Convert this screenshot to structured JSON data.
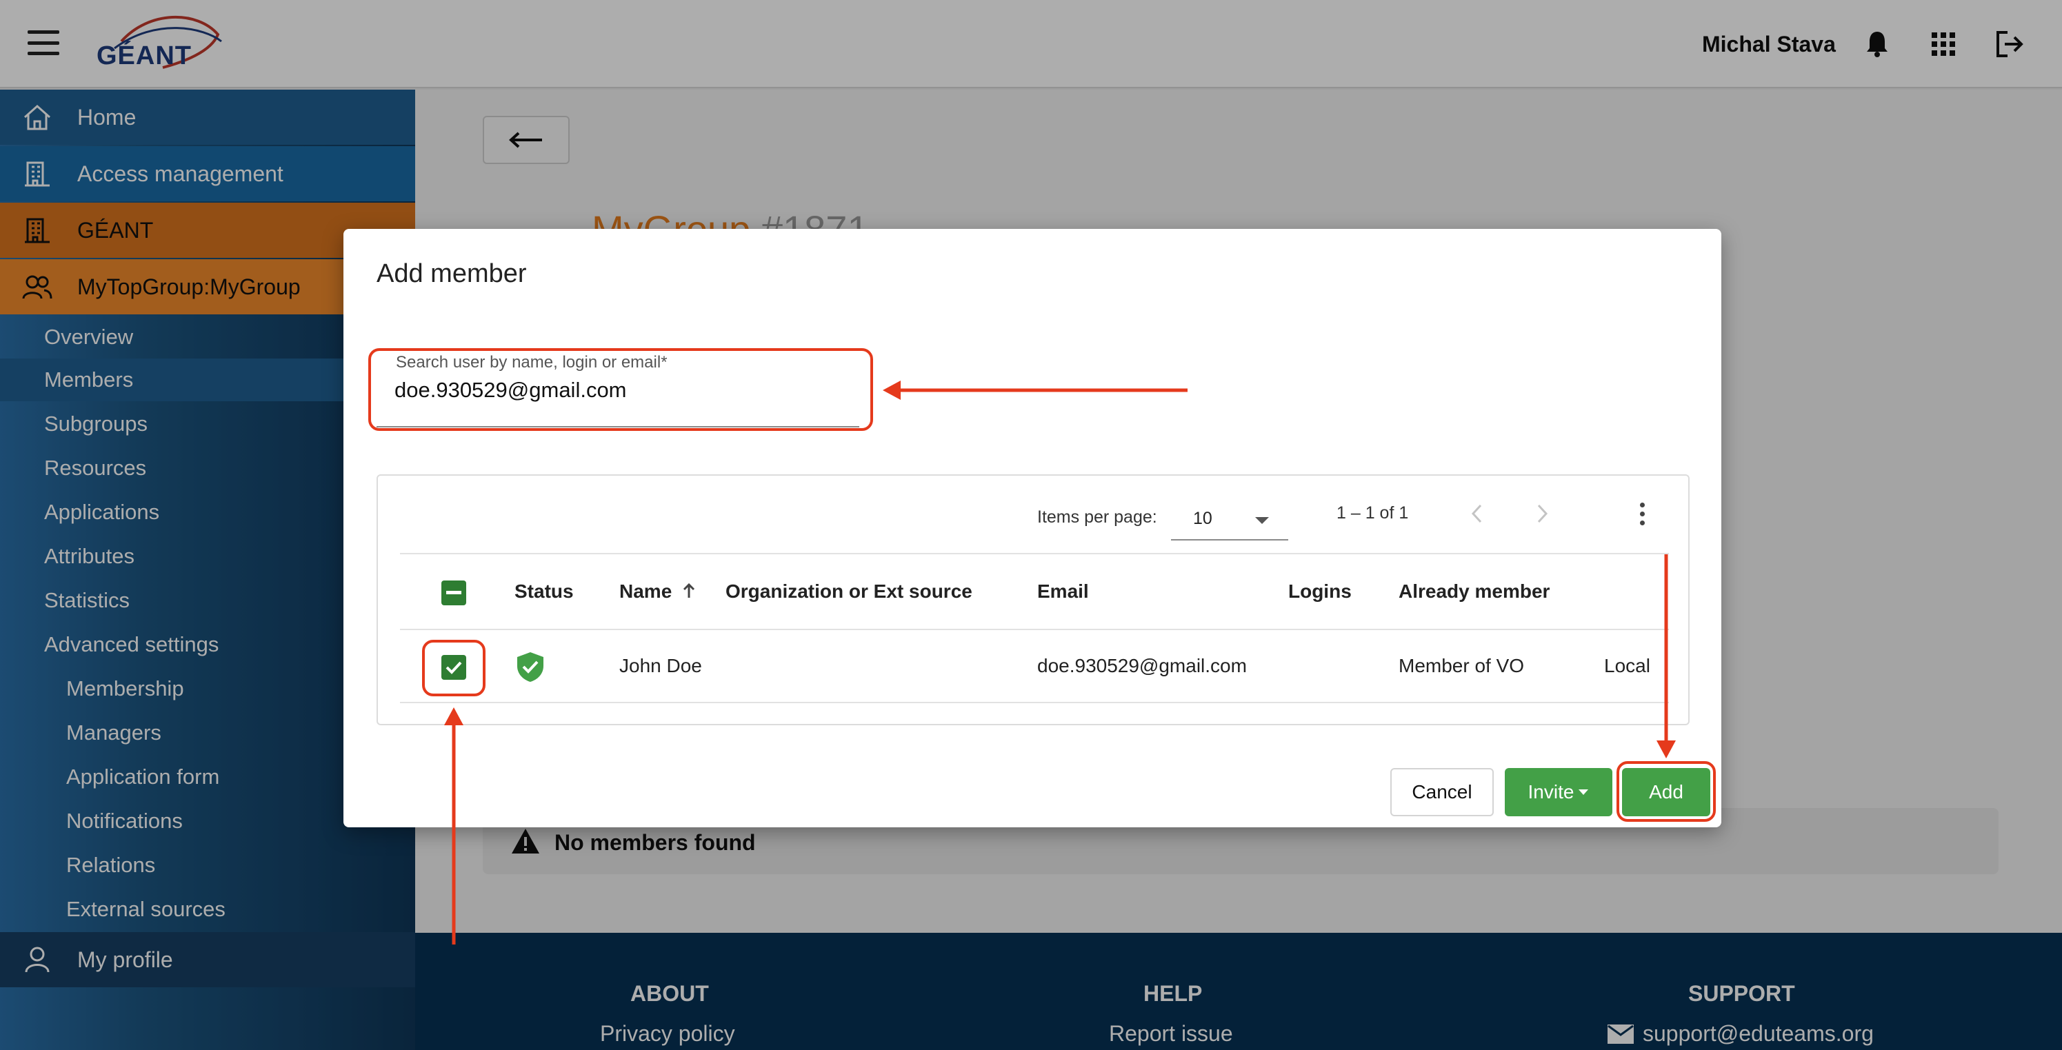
{
  "header": {
    "logo_text": "GÉANT",
    "username": "Michal Stava"
  },
  "sidebar": {
    "items": [
      {
        "label": "Home",
        "icon": "home-icon"
      },
      {
        "label": "Access management",
        "icon": "building-icon"
      },
      {
        "label": "GÉANT",
        "icon": "building-icon"
      },
      {
        "label": "MyTopGroup:MyGroup",
        "icon": "group-icon"
      }
    ],
    "sub_items": [
      "Overview",
      "Members",
      "Subgroups",
      "Resources",
      "Applications",
      "Attributes",
      "Statistics",
      "Advanced settings"
    ],
    "advanced_items": [
      "Membership",
      "Managers",
      "Application form",
      "Notifications",
      "Relations",
      "External sources"
    ],
    "profile_label": "My profile"
  },
  "main": {
    "group_name": "MyGroup",
    "group_id": "#1871",
    "no_members": "No members found"
  },
  "footer": {
    "about": "ABOUT",
    "about_link": "Privacy policy",
    "help": "HELP",
    "help_link": "Report issue",
    "support": "SUPPORT",
    "support_link": "support@eduteams.org"
  },
  "dialog": {
    "title": "Add member",
    "search_label": "Search user by name, login or email*",
    "search_value": "doe.930529@gmail.com",
    "paginator": {
      "items_label": "Items per page:",
      "page_size": "10",
      "range": "1 – 1 of 1"
    },
    "columns": [
      "Status",
      "Name",
      "Organization or Ext source",
      "Email",
      "Logins",
      "Already member"
    ],
    "rows": [
      {
        "name": "John Doe",
        "organization": "",
        "email": "doe.930529@gmail.com",
        "logins": "",
        "already_member": "Member of VO",
        "extra": "Local"
      }
    ],
    "buttons": {
      "cancel": "Cancel",
      "invite": "Invite",
      "add": "Add"
    }
  },
  "colors": {
    "accent_green": "#43a047",
    "annotation_red": "#e53a1c",
    "brand_orange": "#e57c1e",
    "footer_navy": "#063154"
  }
}
